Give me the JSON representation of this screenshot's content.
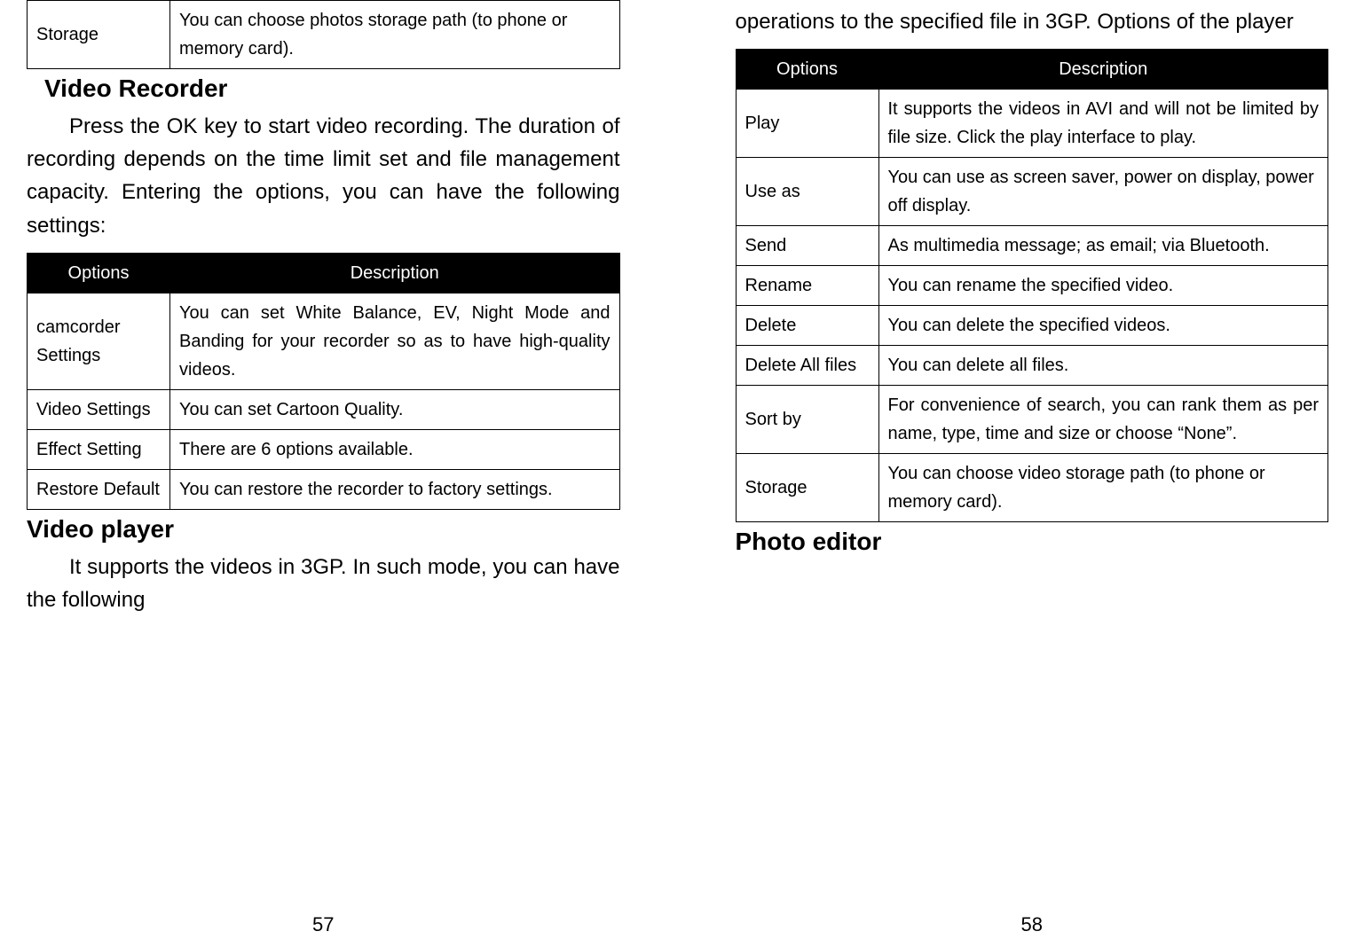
{
  "left": {
    "storageTable": {
      "rows": [
        {
          "opt": "Storage",
          "desc": "You can choose photos storage path (to phone or memory card)."
        }
      ]
    },
    "sec1": "Video Recorder",
    "para1": "Press the OK key to start video recording. The duration of recording depends on the time limit set and file management capacity. Entering the options, you can have the following settings:",
    "optionsTable": {
      "h1": "Options",
      "h2": "Description",
      "rows": [
        {
          "opt": "camcorder Settings",
          "desc": "You can set White Balance, EV, Night Mode and Banding for your recorder so as to have high-quality videos."
        },
        {
          "opt": "Video Settings",
          "desc": "You can set Cartoon Quality."
        },
        {
          "opt": "Effect Setting",
          "desc": "There are 6 options available."
        },
        {
          "opt": "Restore Default",
          "desc": "You can restore the recorder to factory settings."
        }
      ]
    },
    "sec2": "Video player",
    "para2": "It supports the videos in 3GP. In such mode, you can have the following",
    "pageNum": "57"
  },
  "right": {
    "paraTop": "operations to the specified file in 3GP. Options of the player",
    "playerTable": {
      "h1": "Options",
      "h2": "Description",
      "rows": [
        {
          "opt": "Play",
          "desc": "It supports the videos in AVI and will not be limited by file size. Click the play interface to play."
        },
        {
          "opt": "Use as",
          "desc": "You can use as screen saver, power on display, power off display."
        },
        {
          "opt": "Send",
          "desc": "As multimedia message; as email; via Bluetooth."
        },
        {
          "opt": "Rename",
          "desc": "You can rename the specified video."
        },
        {
          "opt": "Delete",
          "desc": "You can delete the specified videos."
        },
        {
          "opt": "Delete All files",
          "desc": "You can delete all files."
        },
        {
          "opt": "Sort by",
          "desc": "For convenience of search, you can rank them as per name, type, time and size or choose “None”."
        },
        {
          "opt": "Storage",
          "desc": "You can choose video storage path (to phone or memory card)."
        }
      ]
    },
    "sec1": "Photo editor",
    "pageNum": "58"
  }
}
